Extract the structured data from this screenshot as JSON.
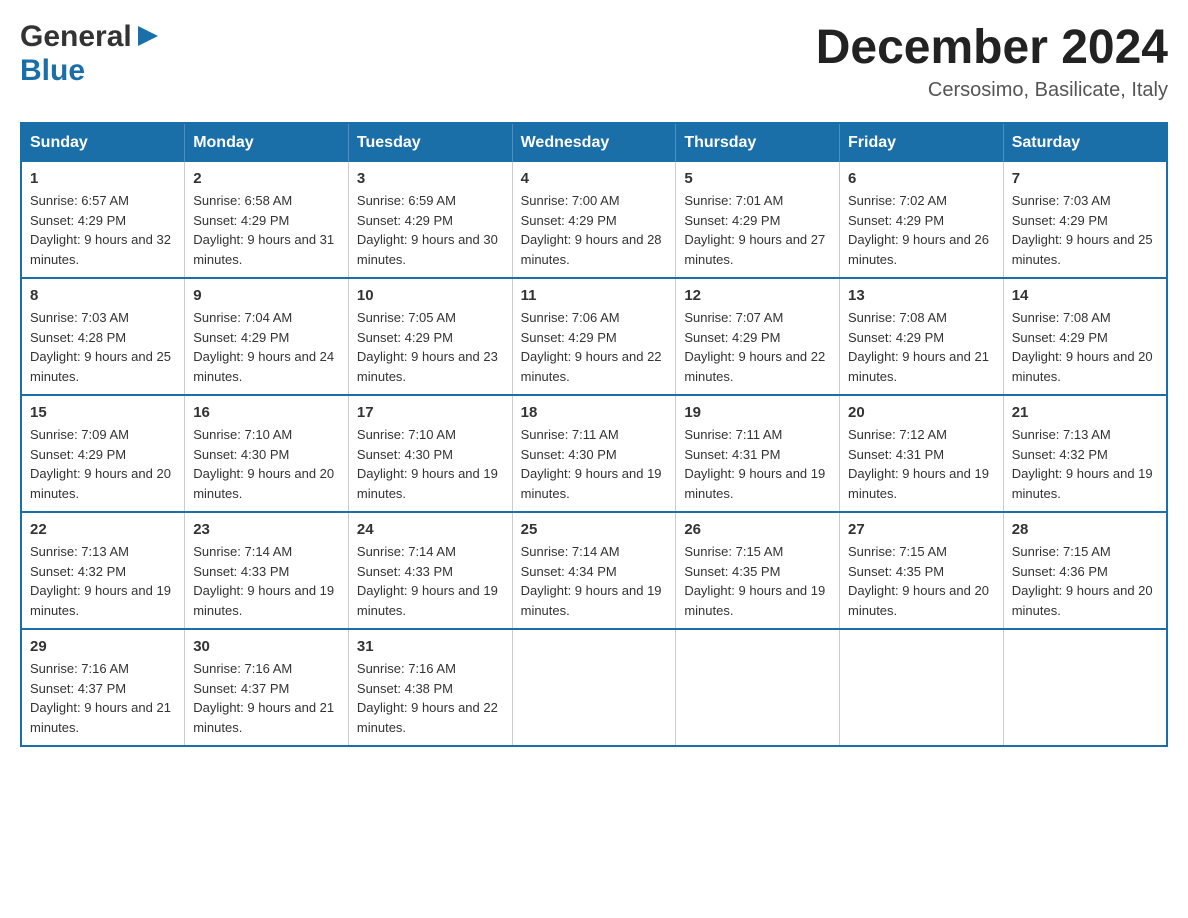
{
  "header": {
    "logo_general": "General",
    "logo_blue": "Blue",
    "month": "December 2024",
    "location": "Cersosimo, Basilicate, Italy"
  },
  "days_of_week": [
    "Sunday",
    "Monday",
    "Tuesday",
    "Wednesday",
    "Thursday",
    "Friday",
    "Saturday"
  ],
  "weeks": [
    [
      {
        "day": "1",
        "sunrise": "6:57 AM",
        "sunset": "4:29 PM",
        "daylight": "9 hours and 32 minutes."
      },
      {
        "day": "2",
        "sunrise": "6:58 AM",
        "sunset": "4:29 PM",
        "daylight": "9 hours and 31 minutes."
      },
      {
        "day": "3",
        "sunrise": "6:59 AM",
        "sunset": "4:29 PM",
        "daylight": "9 hours and 30 minutes."
      },
      {
        "day": "4",
        "sunrise": "7:00 AM",
        "sunset": "4:29 PM",
        "daylight": "9 hours and 28 minutes."
      },
      {
        "day": "5",
        "sunrise": "7:01 AM",
        "sunset": "4:29 PM",
        "daylight": "9 hours and 27 minutes."
      },
      {
        "day": "6",
        "sunrise": "7:02 AM",
        "sunset": "4:29 PM",
        "daylight": "9 hours and 26 minutes."
      },
      {
        "day": "7",
        "sunrise": "7:03 AM",
        "sunset": "4:29 PM",
        "daylight": "9 hours and 25 minutes."
      }
    ],
    [
      {
        "day": "8",
        "sunrise": "7:03 AM",
        "sunset": "4:28 PM",
        "daylight": "9 hours and 25 minutes."
      },
      {
        "day": "9",
        "sunrise": "7:04 AM",
        "sunset": "4:29 PM",
        "daylight": "9 hours and 24 minutes."
      },
      {
        "day": "10",
        "sunrise": "7:05 AM",
        "sunset": "4:29 PM",
        "daylight": "9 hours and 23 minutes."
      },
      {
        "day": "11",
        "sunrise": "7:06 AM",
        "sunset": "4:29 PM",
        "daylight": "9 hours and 22 minutes."
      },
      {
        "day": "12",
        "sunrise": "7:07 AM",
        "sunset": "4:29 PM",
        "daylight": "9 hours and 22 minutes."
      },
      {
        "day": "13",
        "sunrise": "7:08 AM",
        "sunset": "4:29 PM",
        "daylight": "9 hours and 21 minutes."
      },
      {
        "day": "14",
        "sunrise": "7:08 AM",
        "sunset": "4:29 PM",
        "daylight": "9 hours and 20 minutes."
      }
    ],
    [
      {
        "day": "15",
        "sunrise": "7:09 AM",
        "sunset": "4:29 PM",
        "daylight": "9 hours and 20 minutes."
      },
      {
        "day": "16",
        "sunrise": "7:10 AM",
        "sunset": "4:30 PM",
        "daylight": "9 hours and 20 minutes."
      },
      {
        "day": "17",
        "sunrise": "7:10 AM",
        "sunset": "4:30 PM",
        "daylight": "9 hours and 19 minutes."
      },
      {
        "day": "18",
        "sunrise": "7:11 AM",
        "sunset": "4:30 PM",
        "daylight": "9 hours and 19 minutes."
      },
      {
        "day": "19",
        "sunrise": "7:11 AM",
        "sunset": "4:31 PM",
        "daylight": "9 hours and 19 minutes."
      },
      {
        "day": "20",
        "sunrise": "7:12 AM",
        "sunset": "4:31 PM",
        "daylight": "9 hours and 19 minutes."
      },
      {
        "day": "21",
        "sunrise": "7:13 AM",
        "sunset": "4:32 PM",
        "daylight": "9 hours and 19 minutes."
      }
    ],
    [
      {
        "day": "22",
        "sunrise": "7:13 AM",
        "sunset": "4:32 PM",
        "daylight": "9 hours and 19 minutes."
      },
      {
        "day": "23",
        "sunrise": "7:14 AM",
        "sunset": "4:33 PM",
        "daylight": "9 hours and 19 minutes."
      },
      {
        "day": "24",
        "sunrise": "7:14 AM",
        "sunset": "4:33 PM",
        "daylight": "9 hours and 19 minutes."
      },
      {
        "day": "25",
        "sunrise": "7:14 AM",
        "sunset": "4:34 PM",
        "daylight": "9 hours and 19 minutes."
      },
      {
        "day": "26",
        "sunrise": "7:15 AM",
        "sunset": "4:35 PM",
        "daylight": "9 hours and 19 minutes."
      },
      {
        "day": "27",
        "sunrise": "7:15 AM",
        "sunset": "4:35 PM",
        "daylight": "9 hours and 20 minutes."
      },
      {
        "day": "28",
        "sunrise": "7:15 AM",
        "sunset": "4:36 PM",
        "daylight": "9 hours and 20 minutes."
      }
    ],
    [
      {
        "day": "29",
        "sunrise": "7:16 AM",
        "sunset": "4:37 PM",
        "daylight": "9 hours and 21 minutes."
      },
      {
        "day": "30",
        "sunrise": "7:16 AM",
        "sunset": "4:37 PM",
        "daylight": "9 hours and 21 minutes."
      },
      {
        "day": "31",
        "sunrise": "7:16 AM",
        "sunset": "4:38 PM",
        "daylight": "9 hours and 22 minutes."
      },
      null,
      null,
      null,
      null
    ]
  ],
  "labels": {
    "sunrise": "Sunrise:",
    "sunset": "Sunset:",
    "daylight": "Daylight:"
  },
  "colors": {
    "header_bg": "#1a6fa8",
    "header_text": "#ffffff",
    "border": "#1a6fa8"
  }
}
